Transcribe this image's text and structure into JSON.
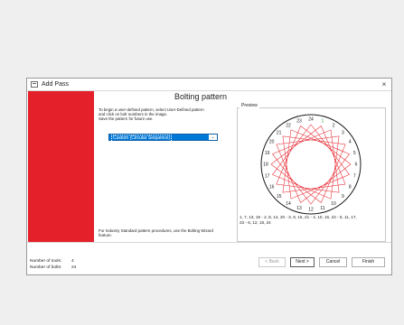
{
  "window": {
    "title": "Add Pass",
    "close_glyph": "×"
  },
  "main": {
    "heading": "Bolting pattern",
    "intro_lines": [
      "To begin a user-defined pattern, select User-Defined pattern",
      "and click on bolt numbers in the image.",
      "Save the pattern for future use."
    ],
    "pattern_select": {
      "value": "Custom (Circular Sequence)",
      "arrow": "⌄"
    },
    "industry_lines": [
      "For Industry Standard pattern procedures, use the Bolting Wizard",
      "feature."
    ]
  },
  "preview": {
    "label": "Preview",
    "bolt_count": 24,
    "bolt_labels": [
      "1",
      "2",
      "3",
      "4",
      "5",
      "6",
      "7",
      "8",
      "9",
      "10",
      "11",
      "12",
      "13",
      "14",
      "15",
      "16",
      "17",
      "18",
      "19",
      "20",
      "21",
      "22",
      "23",
      "24"
    ],
    "sequence_lines": [
      "1, 7, 13, 19 - 2, 8, 14, 20 - 3, 9, 15, 21 - 4, 10, 16, 22 - 5, 11, 17,",
      "23 - 6, 12, 18, 24"
    ],
    "highlight_bolt": "1",
    "colors": {
      "lines": "#e8363e",
      "highlight": "#22a040",
      "ring": "#1a1a1a"
    }
  },
  "footer": {
    "tools_label": "Number of tools:",
    "tools_value": "4",
    "bolts_label": "Number of bolts:",
    "bolts_value": "24",
    "buttons": {
      "back": "< Back",
      "next": "Next >",
      "cancel": "Cancel",
      "finish": "Finish"
    }
  },
  "colors": {
    "accent_red": "#e4202a",
    "select_blue": "#0078d7"
  }
}
